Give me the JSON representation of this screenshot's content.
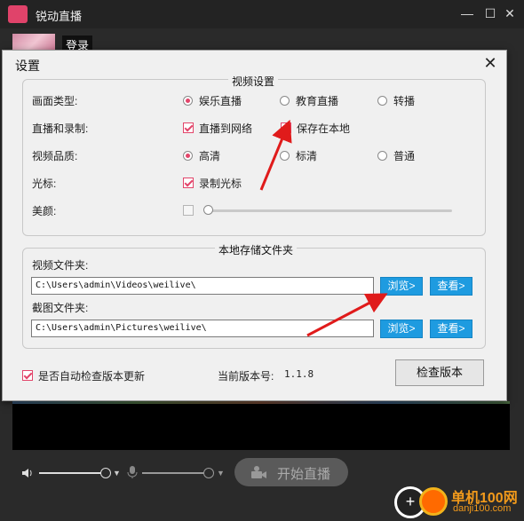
{
  "app": {
    "title": "锐动直播",
    "login_label": "登录",
    "start_live_label": "开始直播",
    "minimize_glyph": "—",
    "maximize_glyph": "☐",
    "close_glyph": "✕"
  },
  "dialog": {
    "title": "设置",
    "close_glyph": "✕",
    "video_settings": {
      "group_title": "视频设置",
      "picture_type": {
        "label": "画面类型:",
        "options": [
          {
            "label": "娱乐直播",
            "selected": true
          },
          {
            "label": "教育直播",
            "selected": false
          },
          {
            "label": "转播",
            "selected": false
          }
        ]
      },
      "live_record": {
        "label": "直播和录制:",
        "options": [
          {
            "label": "直播到网络",
            "checked": true
          },
          {
            "label": "保存在本地",
            "checked": true
          }
        ]
      },
      "video_quality": {
        "label": "视频品质:",
        "options": [
          {
            "label": "高清",
            "selected": true
          },
          {
            "label": "标清",
            "selected": false
          },
          {
            "label": "普通",
            "selected": false
          }
        ]
      },
      "cursor": {
        "label": "光标:",
        "option": {
          "label": "录制光标",
          "checked": true
        }
      },
      "beauty": {
        "label": "美颜:",
        "enabled": false,
        "level": 0
      }
    },
    "storage": {
      "group_title": "本地存储文件夹",
      "video_folder": {
        "label": "视频文件夹:",
        "value": "C:\\Users\\admin\\Videos\\weilive\\",
        "browse_label": "浏览>",
        "view_label": "查看>"
      },
      "screenshot_folder": {
        "label": "截图文件夹:",
        "value": "C:\\Users\\admin\\Pictures\\weilive\\",
        "browse_label": "浏览>",
        "view_label": "查看>"
      }
    },
    "footer": {
      "auto_update_label": "是否自动检查版本更新",
      "auto_update_checked": true,
      "version_label": "当前版本号:",
      "version_value": "1.1.8",
      "check_version_label": "检查版本"
    }
  },
  "watermark": {
    "line1": "单机100网",
    "line2": "danji100.com",
    "glyph": "+"
  },
  "colors": {
    "accent_pink": "#e2456a",
    "button_blue": "#1e9be0",
    "arrow_red": "#e01b1b"
  }
}
